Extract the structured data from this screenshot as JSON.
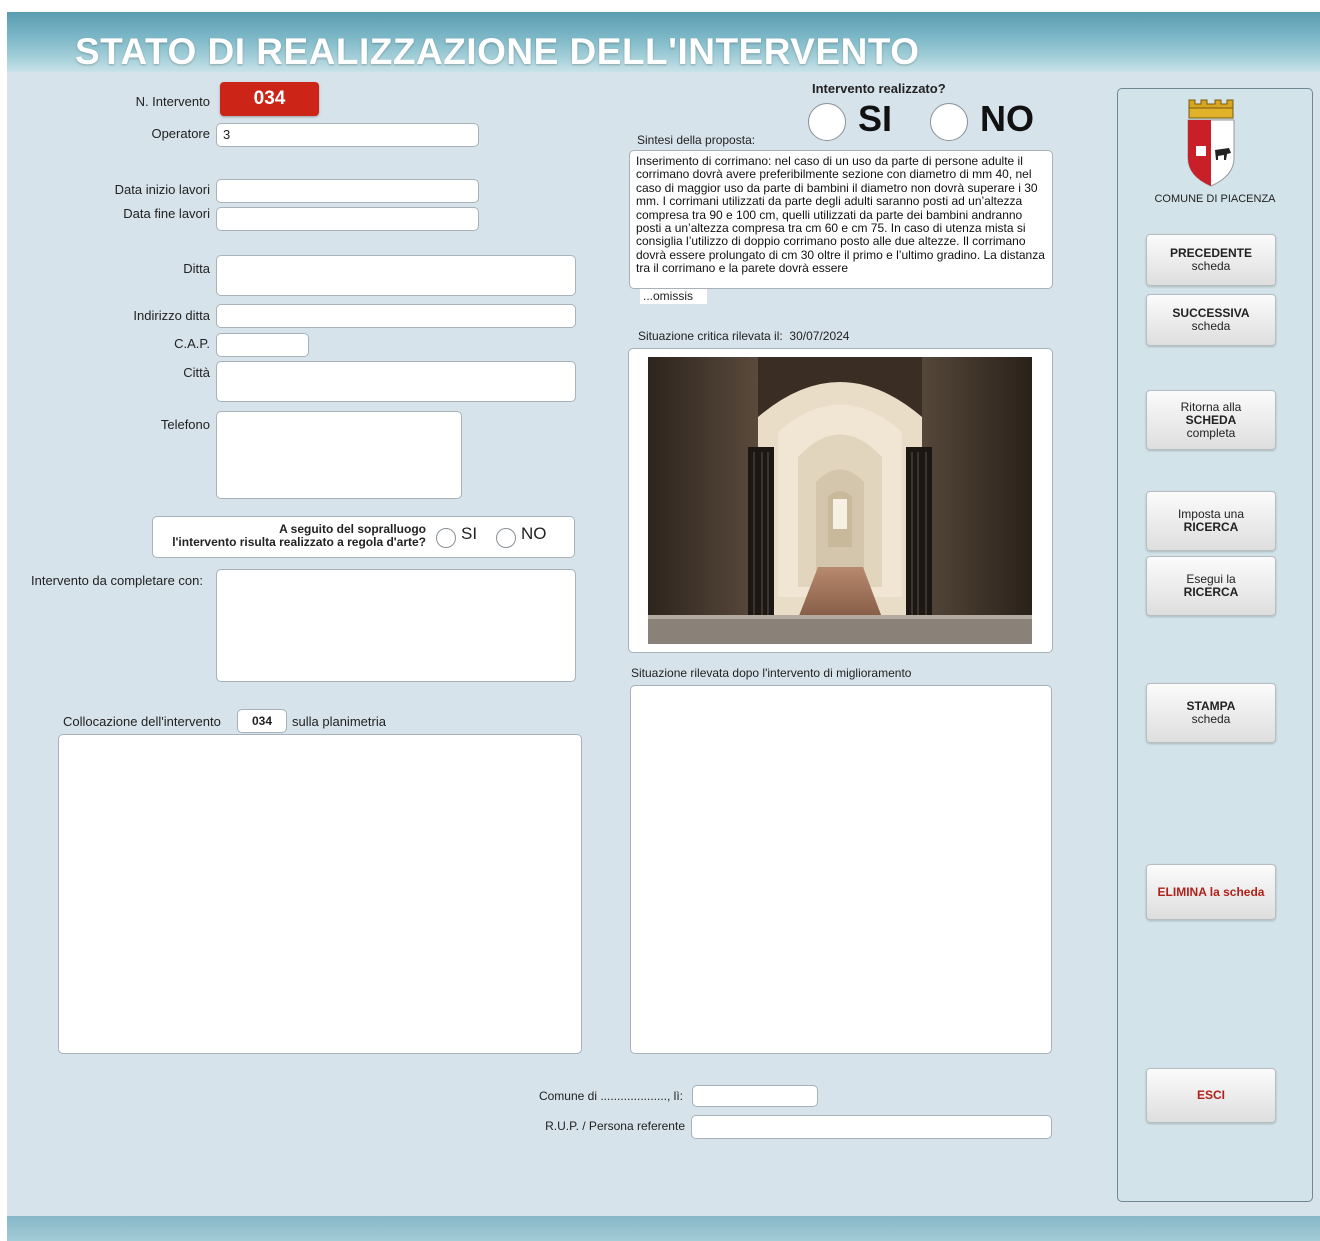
{
  "title": "STATO DI REALIZZAZIONE DELL'INTERVENTO",
  "form": {
    "n_intervento_label": "N. Intervento",
    "n_intervento": "034",
    "operatore_label": "Operatore",
    "operatore": "3",
    "data_inizio_label": "Data inizio lavori",
    "data_inizio": "",
    "data_fine_label": "Data fine lavori",
    "data_fine": "",
    "ditta_label": "Ditta",
    "indirizzo_label": "Indirizzo ditta",
    "cap_label": "C.A.P.",
    "citta_label": "Città",
    "telefono_label": "Telefono",
    "sopralluogo_line1": "A seguito del sopralluogo",
    "sopralluogo_line2": "l'intervento risulta realizzato a regola d'arte?",
    "si": "SI",
    "no": "NO",
    "completare_label": "Intervento da completare con:",
    "collocazione_prefix": "Collocazione dell'intervento",
    "collocazione_num": "034",
    "collocazione_suffix": "sulla planimetria",
    "comune_label": "Comune di ...................., lì:",
    "rup_label": "R.U.P. / Persona referente"
  },
  "center": {
    "realizzato_label": "Intervento realizzato?",
    "si": "SI",
    "no": "NO",
    "sintesi_label": "Sintesi della proposta:",
    "sintesi_text": "Inserimento di corrimano: nel caso di un uso da parte di persone adulte il corrimano dovrà avere preferibilmente sezione con diametro di mm 40, nel caso di maggior uso da parte di bambini il diametro non dovrà superare i 30 mm. I corrimani utilizzati da parte degli adulti saranno posti ad un’altezza compresa tra 90 e 100 cm, quelli utilizzati da parte dei bambini andranno posti a un’altezza compresa tra cm 60 e cm 75. In caso di utenza mista si consiglia l’utilizzo di doppio corrimano posto alle due altezze. Il corrimano dovrà essere prolungato di cm 30 oltre il primo e l’ultimo gradino.  La distanza tra il corrimano e la parete dovrà essere",
    "omissis": "...omissis",
    "critica_label": "Situazione critica rilevata il:",
    "critica_date": "30/07/2024",
    "dopo_label": "Situazione rilevata dopo l'intervento di miglioramento"
  },
  "sidebar": {
    "comune": "COMUNE DI PIACENZA",
    "precedente_1": "PRECEDENTE",
    "precedente_2": "scheda",
    "successiva_1": "SUCCESSIVA",
    "successiva_2": "scheda",
    "ritorna_1": "Ritorna alla",
    "ritorna_2": "SCHEDA",
    "ritorna_3": "completa",
    "imposta_1": "Imposta una",
    "imposta_2": "RICERCA",
    "esegui_1": "Esegui la",
    "esegui_2": "RICERCA",
    "stampa_1": "STAMPA",
    "stampa_2": "scheda",
    "elimina": "ELIMINA la scheda",
    "esci": "ESCI"
  },
  "colors": {
    "badge": "#cc2518",
    "header": "#7ab6c6",
    "elimina_text": "#b0211a",
    "background": "#d7e3ea"
  }
}
